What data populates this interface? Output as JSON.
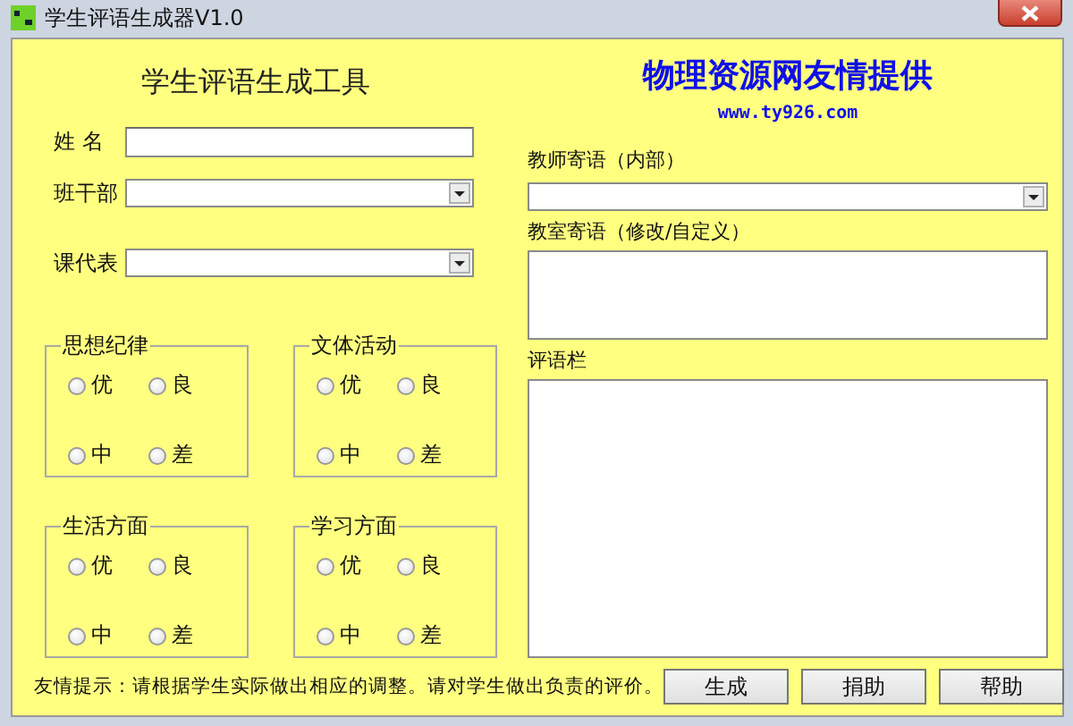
{
  "window": {
    "title": "学生评语生成器V1.0"
  },
  "heading": "学生评语生成工具",
  "sponsor": {
    "title": "物理资源网友情提供",
    "url": "www.ty926.com"
  },
  "fields": [
    {
      "label": "姓 名",
      "kind": "text"
    },
    {
      "label": "班干部",
      "kind": "combo"
    },
    {
      "label": "课代表",
      "kind": "combo"
    }
  ],
  "groups": [
    {
      "title": "思想纪律",
      "options": [
        {
          "label": "优",
          "selected": false
        },
        {
          "label": "良",
          "selected": false
        },
        {
          "label": "中",
          "selected": false
        },
        {
          "label": "差",
          "selected": false
        }
      ]
    },
    {
      "title": "文体活动",
      "options": [
        {
          "label": "优",
          "selected": false
        },
        {
          "label": "良",
          "selected": false
        },
        {
          "label": "中",
          "selected": false
        },
        {
          "label": "差",
          "selected": false
        }
      ]
    },
    {
      "title": "生活方面",
      "options": [
        {
          "label": "优",
          "selected": false
        },
        {
          "label": "良",
          "selected": false
        },
        {
          "label": "中",
          "selected": false
        },
        {
          "label": "差",
          "selected": false
        }
      ]
    },
    {
      "title": "学习方面",
      "options": [
        {
          "label": "优",
          "selected": false
        },
        {
          "label": "良",
          "selected": false
        },
        {
          "label": "中",
          "selected": false
        },
        {
          "label": "差",
          "selected": false
        }
      ]
    }
  ],
  "right_fields": [
    {
      "label": "教师寄语（内部）",
      "kind": "combo"
    },
    {
      "label": "教室寄语（修改/自定义）",
      "kind": "memo"
    },
    {
      "label": "评语栏",
      "kind": "memo"
    }
  ],
  "hint": "友情提示：请根据学生实际做出相应的调整。请对学生做出负责的评价。",
  "buttons": [
    "生成",
    "捐助",
    "帮助"
  ]
}
